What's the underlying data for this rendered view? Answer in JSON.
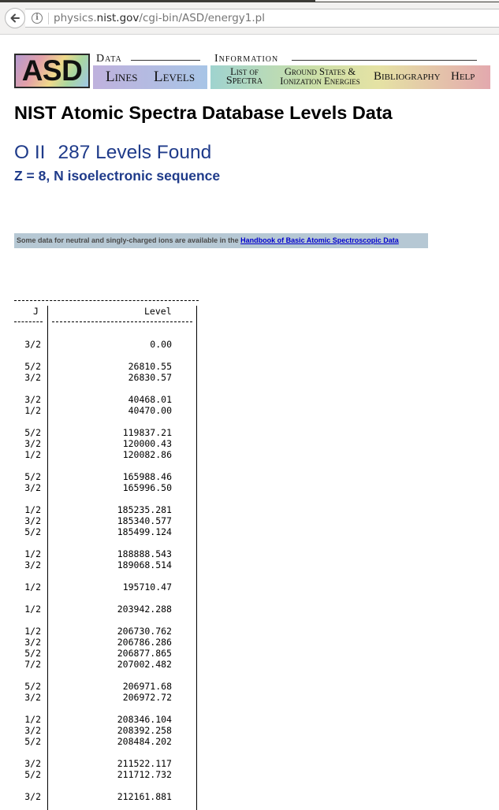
{
  "browser": {
    "back_icon": "back-arrow-icon",
    "info_icon": "info-icon",
    "info_glyph": "i",
    "url_prefix": "physics.",
    "url_host": "nist.gov",
    "url_path": "/cgi-bin/ASD/energy1.pl"
  },
  "banner": {
    "logo": "ASD",
    "data_title": "Data",
    "information_title": "Information",
    "lines": "Lines",
    "levels": "Levels",
    "list_of_spectra_1": "List of",
    "list_of_spectra_2": "Spectra",
    "ground_states_1": "Ground States &",
    "ground_states_2": "Ionization Energies",
    "bibliography": "Bibliography",
    "help": "Help"
  },
  "page": {
    "title": "NIST Atomic Spectra Database Levels Data",
    "ion": "O II",
    "levels_found": "287 Levels Found",
    "sequence": "Z = 8, N isoelectronic sequence",
    "notice_text": "Some data for neutral and singly-charged ions are available in the",
    "notice_link": "Handbook of Basic Atomic Spectroscopic Data"
  },
  "table": {
    "col_j": "J",
    "col_level": "Level",
    "groups": [
      [
        {
          "j": "3/2",
          "level": "0.00"
        }
      ],
      [
        {
          "j": "5/2",
          "level": "26810.55"
        },
        {
          "j": "3/2",
          "level": "26830.57"
        }
      ],
      [
        {
          "j": "3/2",
          "level": "40468.01"
        },
        {
          "j": "1/2",
          "level": "40470.00"
        }
      ],
      [
        {
          "j": "5/2",
          "level": "119837.21"
        },
        {
          "j": "3/2",
          "level": "120000.43"
        },
        {
          "j": "1/2",
          "level": "120082.86"
        }
      ],
      [
        {
          "j": "5/2",
          "level": "165988.46"
        },
        {
          "j": "3/2",
          "level": "165996.50"
        }
      ],
      [
        {
          "j": "1/2",
          "level": "185235.281"
        },
        {
          "j": "3/2",
          "level": "185340.577"
        },
        {
          "j": "5/2",
          "level": "185499.124"
        }
      ],
      [
        {
          "j": "1/2",
          "level": "188888.543"
        },
        {
          "j": "3/2",
          "level": "189068.514"
        }
      ],
      [
        {
          "j": "1/2",
          "level": "195710.47"
        }
      ],
      [
        {
          "j": "1/2",
          "level": "203942.288"
        }
      ],
      [
        {
          "j": "1/2",
          "level": "206730.762"
        },
        {
          "j": "3/2",
          "level": "206786.286"
        },
        {
          "j": "5/2",
          "level": "206877.865"
        },
        {
          "j": "7/2",
          "level": "207002.482"
        }
      ],
      [
        {
          "j": "5/2",
          "level": "206971.68"
        },
        {
          "j": "3/2",
          "level": "206972.72"
        }
      ],
      [
        {
          "j": "1/2",
          "level": "208346.104"
        },
        {
          "j": "3/2",
          "level": "208392.258"
        },
        {
          "j": "5/2",
          "level": "208484.202"
        }
      ],
      [
        {
          "j": "3/2",
          "level": "211522.117"
        },
        {
          "j": "5/2",
          "level": "211712.732"
        }
      ],
      [
        {
          "j": "3/2",
          "level": "212161.881"
        }
      ]
    ]
  }
}
